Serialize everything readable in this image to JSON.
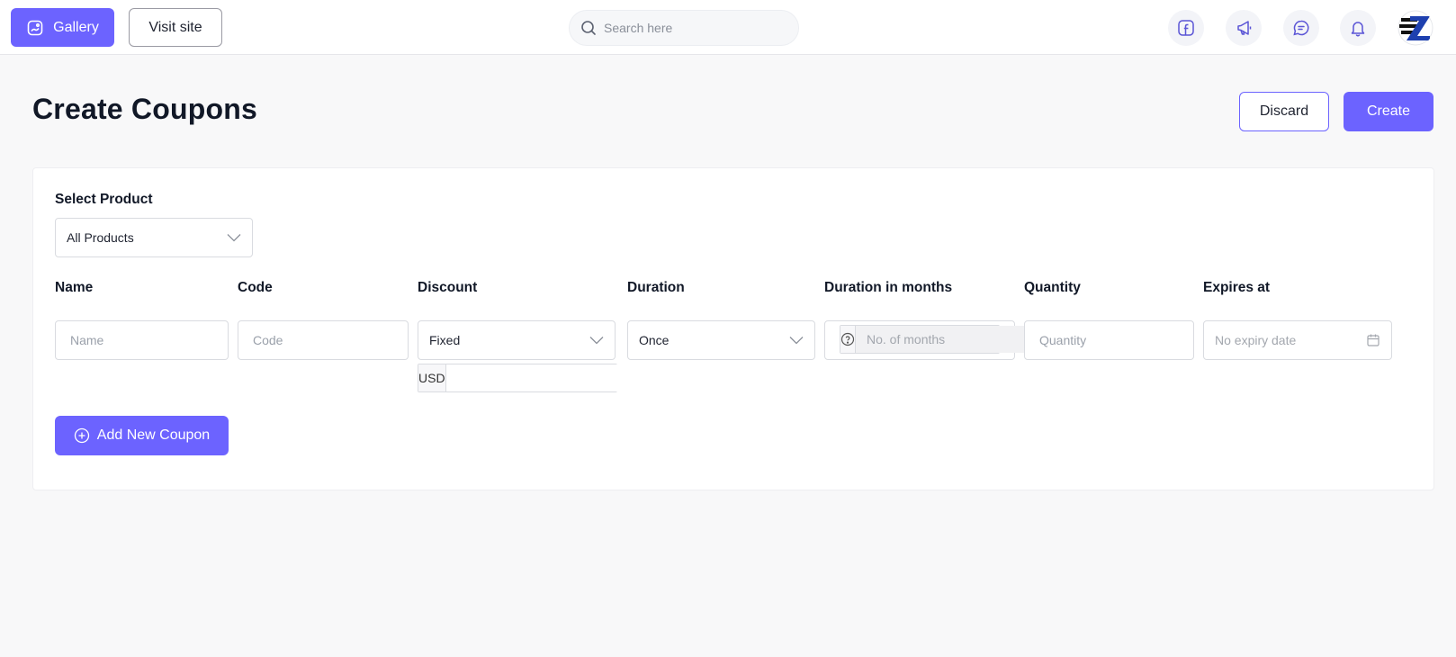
{
  "topbar": {
    "gallery_label": "Gallery",
    "visit_site_label": "Visit site",
    "search_placeholder": "Search here",
    "icons": [
      "facebook-icon",
      "megaphone-icon",
      "chat-icon",
      "bell-icon"
    ]
  },
  "page": {
    "title": "Create Coupons",
    "discard_label": "Discard",
    "create_label": "Create"
  },
  "form": {
    "select_product_label": "Select Product",
    "select_product_value": "All Products",
    "columns": {
      "name": "Name",
      "code": "Code",
      "discount": "Discount",
      "duration": "Duration",
      "duration_months": "Duration in months",
      "quantity": "Quantity",
      "expires_at": "Expires at"
    },
    "name_placeholder": "Name",
    "code_placeholder": "Code",
    "discount_type_value": "Fixed",
    "currency_label": "USD",
    "duration_value": "Once",
    "months_placeholder": "No. of months",
    "quantity_placeholder": "Quantity",
    "expiry_placeholder": "No expiry date",
    "add_coupon_label": "Add New Coupon"
  },
  "colors": {
    "accent": "#6c63ff",
    "background": "#f8f8f9"
  }
}
